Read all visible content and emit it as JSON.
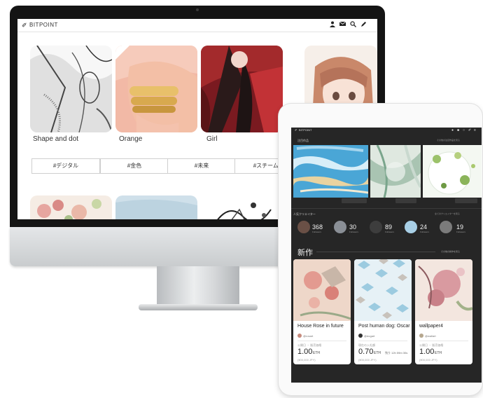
{
  "desktop": {
    "brand": "BITPOINT",
    "artworks": [
      {
        "title": "Shape and dot"
      },
      {
        "title": "Orange"
      },
      {
        "title": "Girl"
      }
    ],
    "tags": [
      "#デジタル",
      "#金色",
      "#未来",
      "#スチームパン"
    ]
  },
  "tablet": {
    "brand": "BITPOINT",
    "pickup_title": "注目作品",
    "pickup_more": "その他の注目作品を見る",
    "creators_title": "人気クリエイター",
    "creators_more": "全てのクリエイターを見る",
    "creators": [
      {
        "followers": "368",
        "label": "Followers"
      },
      {
        "followers": "30",
        "label": "Followers"
      },
      {
        "followers": "89",
        "label": "Followers"
      },
      {
        "followers": "24",
        "label": "Followers"
      },
      {
        "followers": "19",
        "label": "Followers"
      }
    ],
    "new_title": "新作",
    "new_more": "その他の新作を見る",
    "items": [
      {
        "title": "House Rose in future",
        "user": "@rosart",
        "label": "公開日 ・ 販売価格",
        "price": "1.00",
        "unit": "ETH",
        "yen": "(¥00,000 JPY)",
        "extra": ""
      },
      {
        "title": "Post human dog: Oscar",
        "user": "@dogart",
        "label": "現在の入札額",
        "price": "0.70",
        "unit": "ETH",
        "yen": "(¥00,000 JPY)",
        "extra": "残り 12h 59m 30s"
      },
      {
        "title": "wallpaper4",
        "user": "@wallart",
        "label": "公開日 ・ 販売価格",
        "price": "1.00",
        "unit": "ETH",
        "yen": "(¥00,000 JPY)",
        "extra": ""
      }
    ]
  }
}
